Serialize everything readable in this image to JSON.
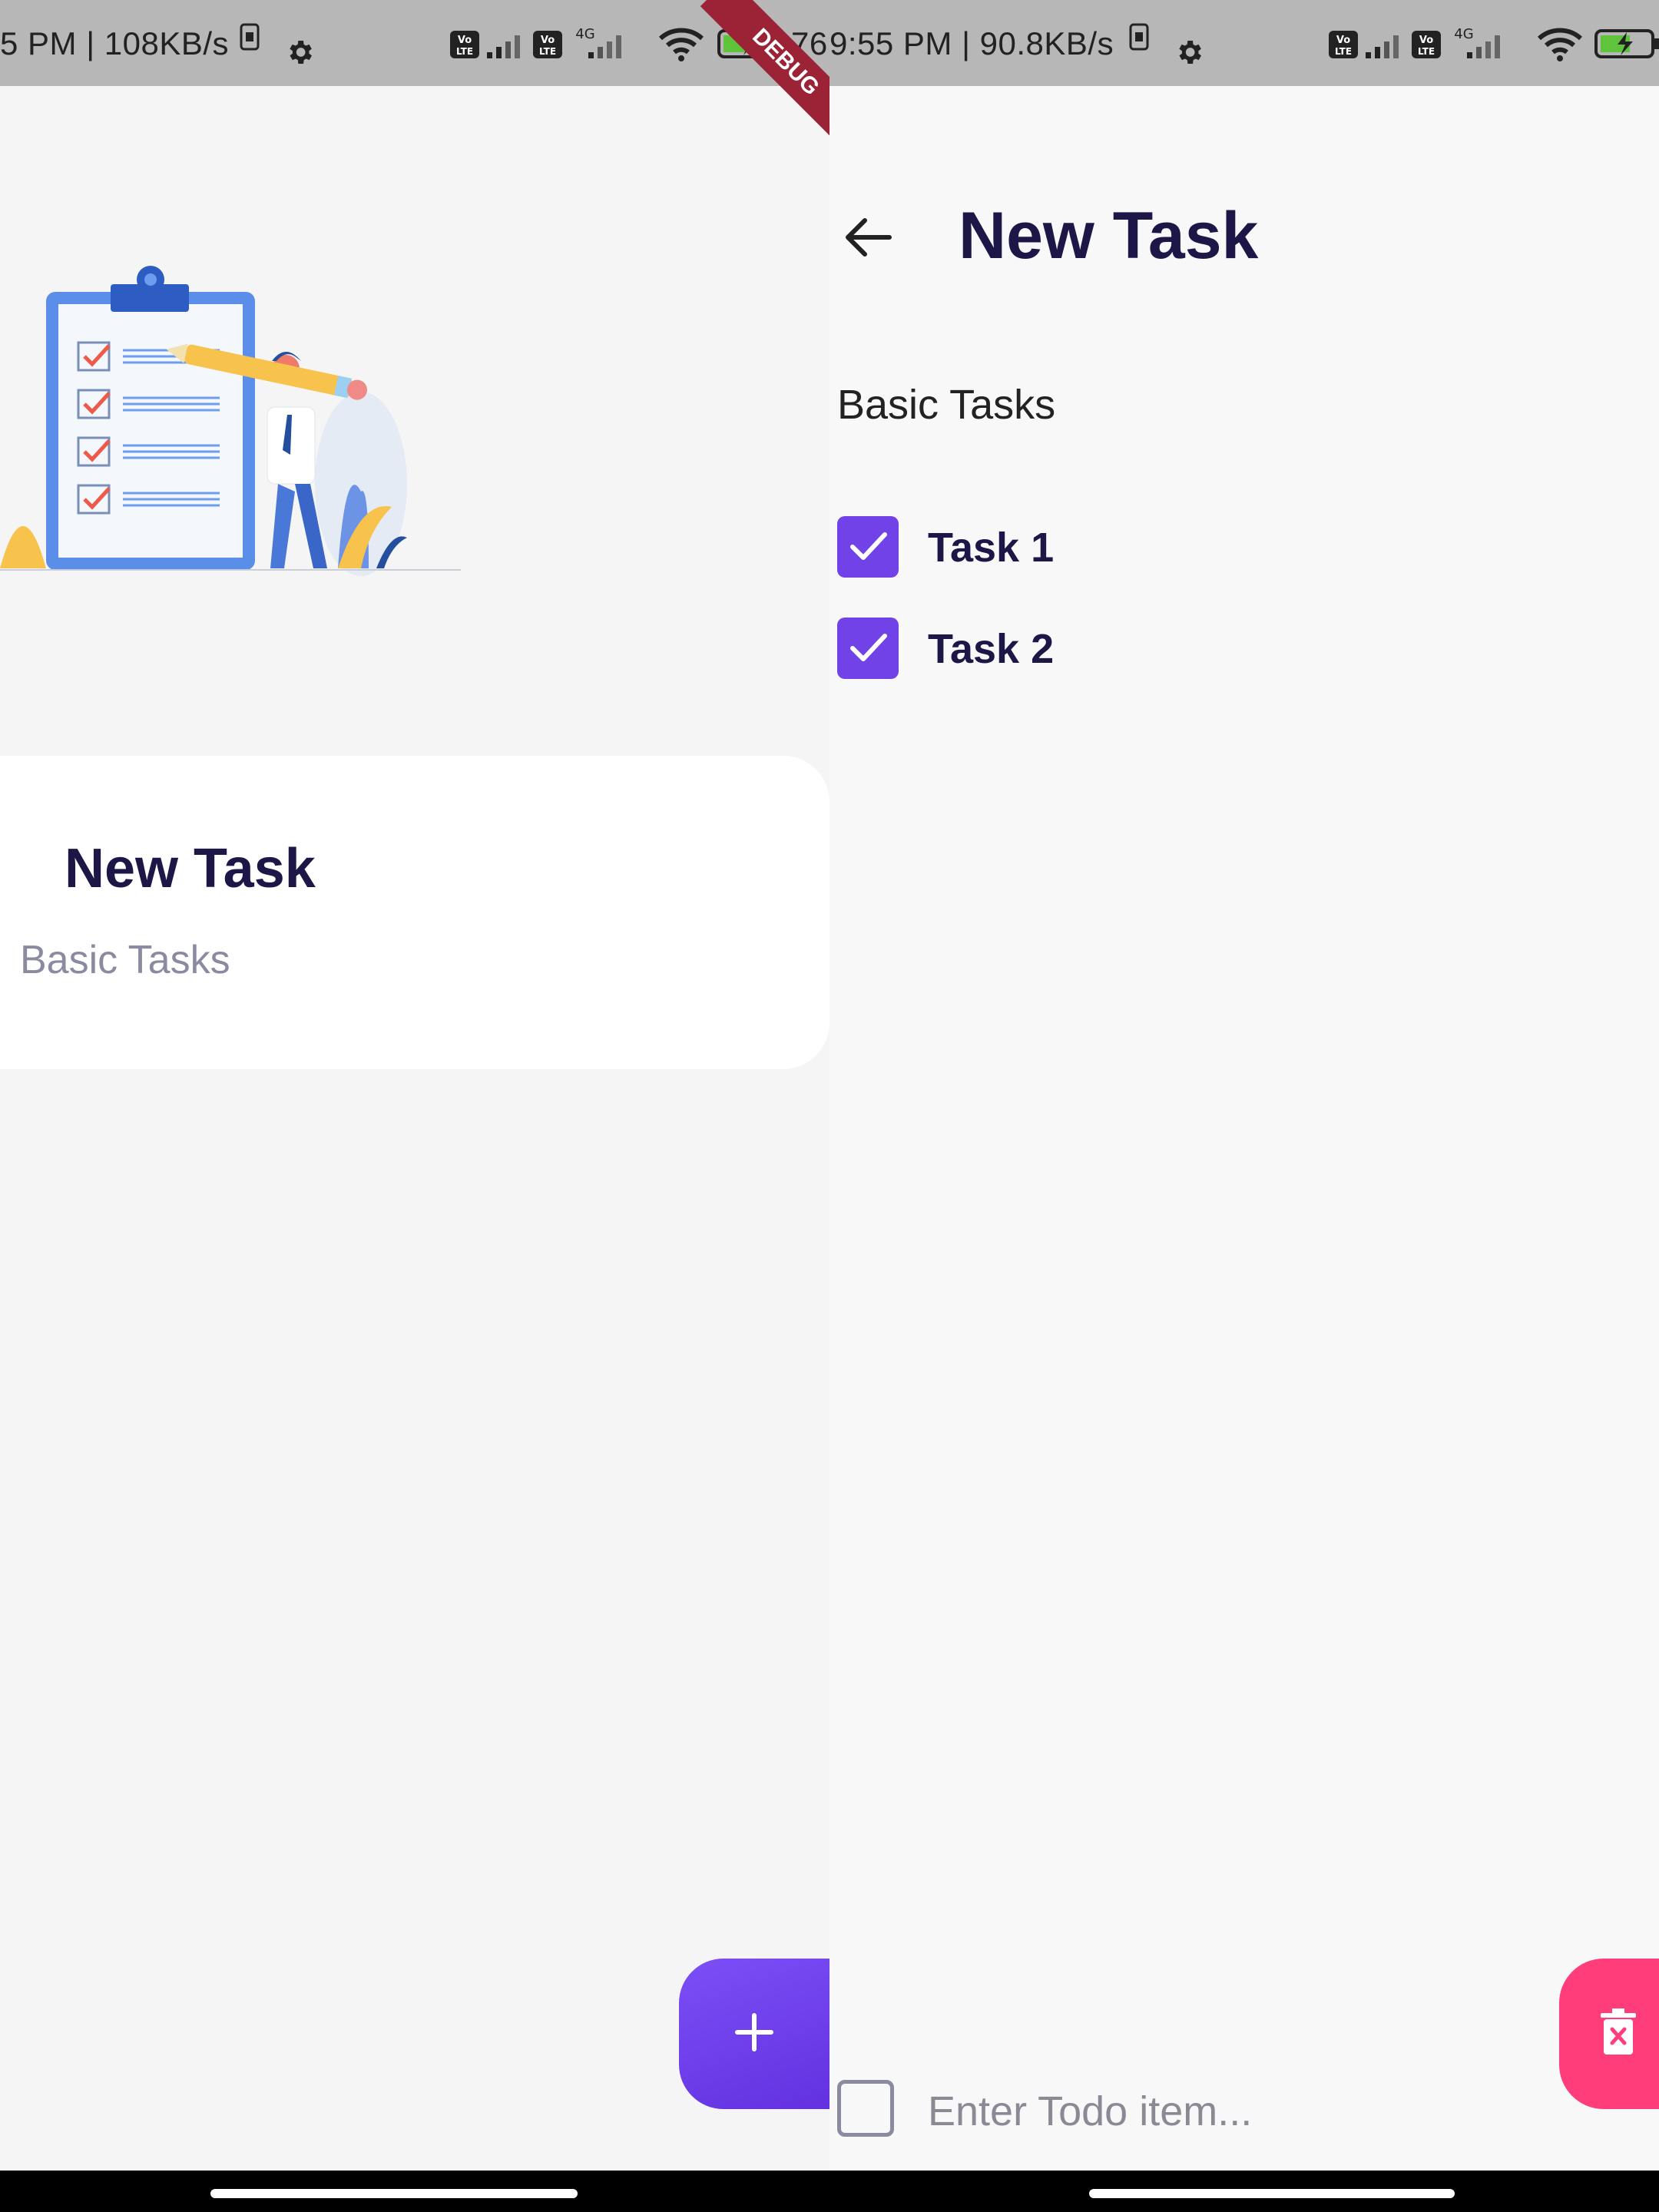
{
  "left_screen": {
    "status_bar": {
      "text": "5 PM | 108KB/s",
      "battery_text": "76"
    },
    "debug_banner": "DEBUG",
    "task_card": {
      "title": "New Task",
      "subtitle": "Basic Tasks"
    },
    "fab": {
      "icon": "plus-icon",
      "color": "#7346f0"
    }
  },
  "right_screen": {
    "status_bar": {
      "text": "9:55 PM | 90.8KB/s"
    },
    "header": {
      "back_icon": "arrow-left-icon",
      "title": "New Task"
    },
    "category": "Basic Tasks",
    "todos": [
      {
        "label": "Task 1",
        "checked": true
      },
      {
        "label": "Task 2",
        "checked": true
      }
    ],
    "new_todo": {
      "placeholder": "Enter Todo item...",
      "value": ""
    },
    "delete_fab": {
      "icon": "trash-x-icon",
      "color": "#ff3d7a"
    }
  },
  "theme": {
    "primary": "#7142e8",
    "title_text": "#1d1748",
    "muted_text": "#8a8aa0"
  }
}
